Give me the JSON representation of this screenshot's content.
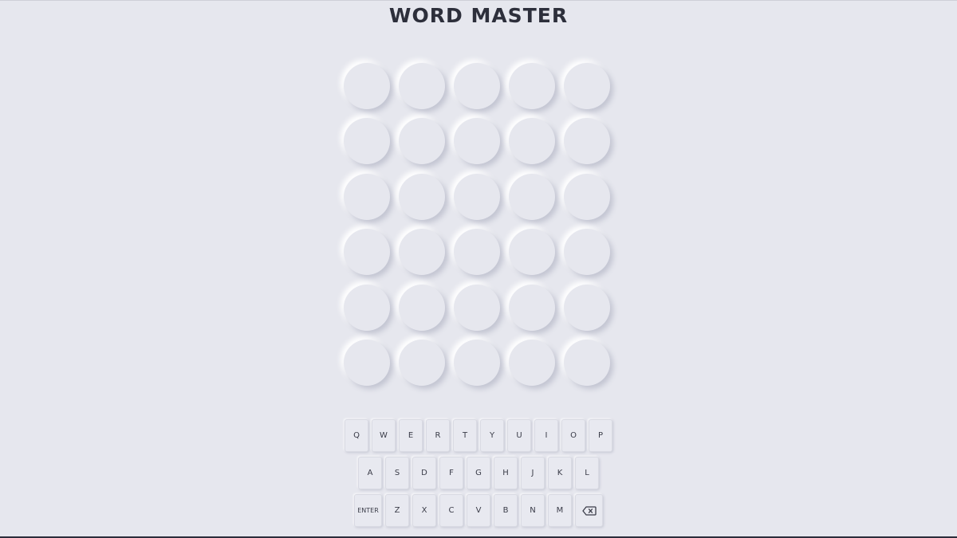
{
  "app": {
    "title": "WORD MASTER"
  },
  "board": {
    "rows": [
      [
        "",
        "",
        "",
        "",
        ""
      ],
      [
        "",
        "",
        "",
        "",
        ""
      ],
      [
        "",
        "",
        "",
        "",
        ""
      ],
      [
        "",
        "",
        "",
        "",
        ""
      ],
      [
        "",
        "",
        "",
        "",
        ""
      ],
      [
        "",
        "",
        "",
        "",
        ""
      ]
    ]
  },
  "keyboard": {
    "row1": [
      "Q",
      "W",
      "E",
      "R",
      "T",
      "Y",
      "U",
      "I",
      "O",
      "P"
    ],
    "row2": [
      "A",
      "S",
      "D",
      "F",
      "G",
      "H",
      "J",
      "K",
      "L"
    ],
    "row3": [
      "Z",
      "X",
      "C",
      "V",
      "B",
      "N",
      "M"
    ],
    "enter_label": "ENTER",
    "backspace_icon": "backspace-icon"
  },
  "colors": {
    "background": "#e6e7ee",
    "text": "#2d2f3b"
  }
}
